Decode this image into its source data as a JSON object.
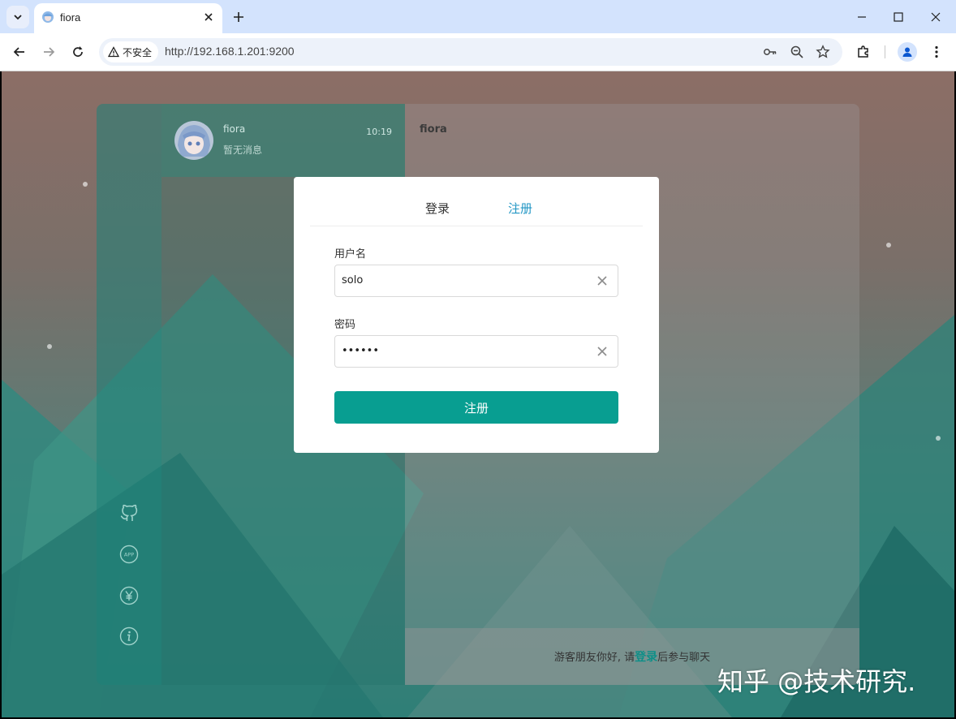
{
  "browser": {
    "tab_title": "fiora",
    "security_label": "不安全",
    "url": "http://192.168.1.201:9200"
  },
  "app": {
    "conversation": {
      "name": "fiora",
      "time": "10:19",
      "preview": "暂无消息"
    },
    "chat_title": "fiora",
    "footer": {
      "prefix": "游客朋友你好, 请",
      "link": "登录",
      "suffix": "后参与聊天"
    },
    "sidebar_icons": [
      "github-icon",
      "app-icon",
      "yen-icon",
      "info-icon"
    ]
  },
  "modal": {
    "tabs": [
      {
        "label": "登录",
        "active": false
      },
      {
        "label": "注册",
        "active": true
      }
    ],
    "username_label": "用户名",
    "username_value": "solo",
    "password_label": "密码",
    "password_value": "••••••",
    "submit_label": "注册"
  },
  "watermark": "知乎 @技术研究.",
  "colors": {
    "accent": "#089e91",
    "active_tab": "#2196c4",
    "link": "#0e8f88"
  }
}
